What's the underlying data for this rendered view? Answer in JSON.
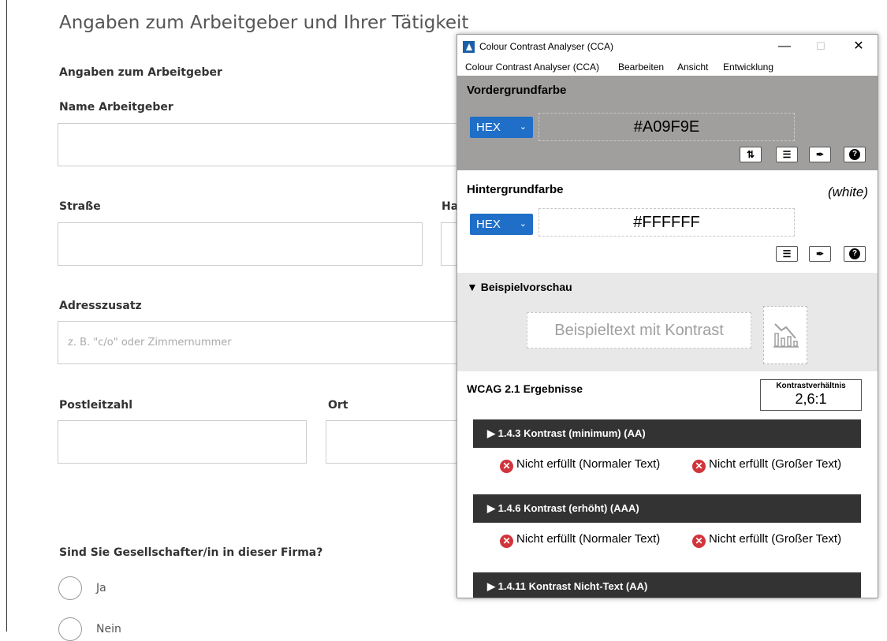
{
  "form": {
    "page_heading": "Angaben zum Arbeitgeber und Ihrer Tätigkeit",
    "section_title": "Angaben zum Arbeitgeber",
    "labels": {
      "employer_name": "Name Arbeitgeber",
      "street": "Straße",
      "house_number_partial": "Ha",
      "address_extra": "Adresszusatz",
      "postal_code": "Postleitzahl",
      "city": "Ort"
    },
    "address_extra_placeholder": "z. B. \"c/o\" oder Zimmernummer",
    "shareholder_question": "Sind Sie Gesellschafter/in in dieser Firma?",
    "radio_yes": "Ja",
    "radio_no": "Nein"
  },
  "cca": {
    "window_title": "Colour Contrast Analyser (CCA)",
    "window_controls": {
      "minimize": "—",
      "maximize": "☐",
      "close": "✕"
    },
    "menu": [
      "Colour Contrast Analyser (CCA)",
      "Bearbeiten",
      "Ansicht",
      "Entwicklung"
    ],
    "foreground": {
      "title": "Vordergrundfarbe",
      "format": "HEX",
      "value": "#A09F9E",
      "color": "#a09f9e"
    },
    "background": {
      "title": "Hintergrundfarbe",
      "color_name": "(white)",
      "format": "HEX",
      "value": "#FFFFFF",
      "color": "#ffffff"
    },
    "tool_icons": {
      "swap": "swap-icon",
      "sliders": "sliders-icon",
      "eyedropper": "eyedropper-icon",
      "help": "help-icon"
    },
    "preview": {
      "title": "▼ Beispielvorschau",
      "sample_text": "Beispieltext mit Kontrast"
    },
    "results": {
      "title": "WCAG 2.1 Ergebnisse",
      "ratio_label": "Kontrastverhältnis",
      "ratio_value": "2,6:1",
      "criteria": [
        {
          "label": "▶  1.4.3 Kontrast (minimum) (AA)",
          "normal": "Nicht erfüllt (Normaler Text)",
          "large": "Nicht erfüllt (Großer Text)"
        },
        {
          "label": "▶  1.4.6 Kontrast (erhöht) (AAA)",
          "normal": "Nicht erfüllt (Normaler Text)",
          "large": "Nicht erfüllt (Großer Text)"
        },
        {
          "label": "▶  1.4.11 Kontrast Nicht-Text (AA)"
        }
      ],
      "fail_color": "#d1343b"
    }
  }
}
